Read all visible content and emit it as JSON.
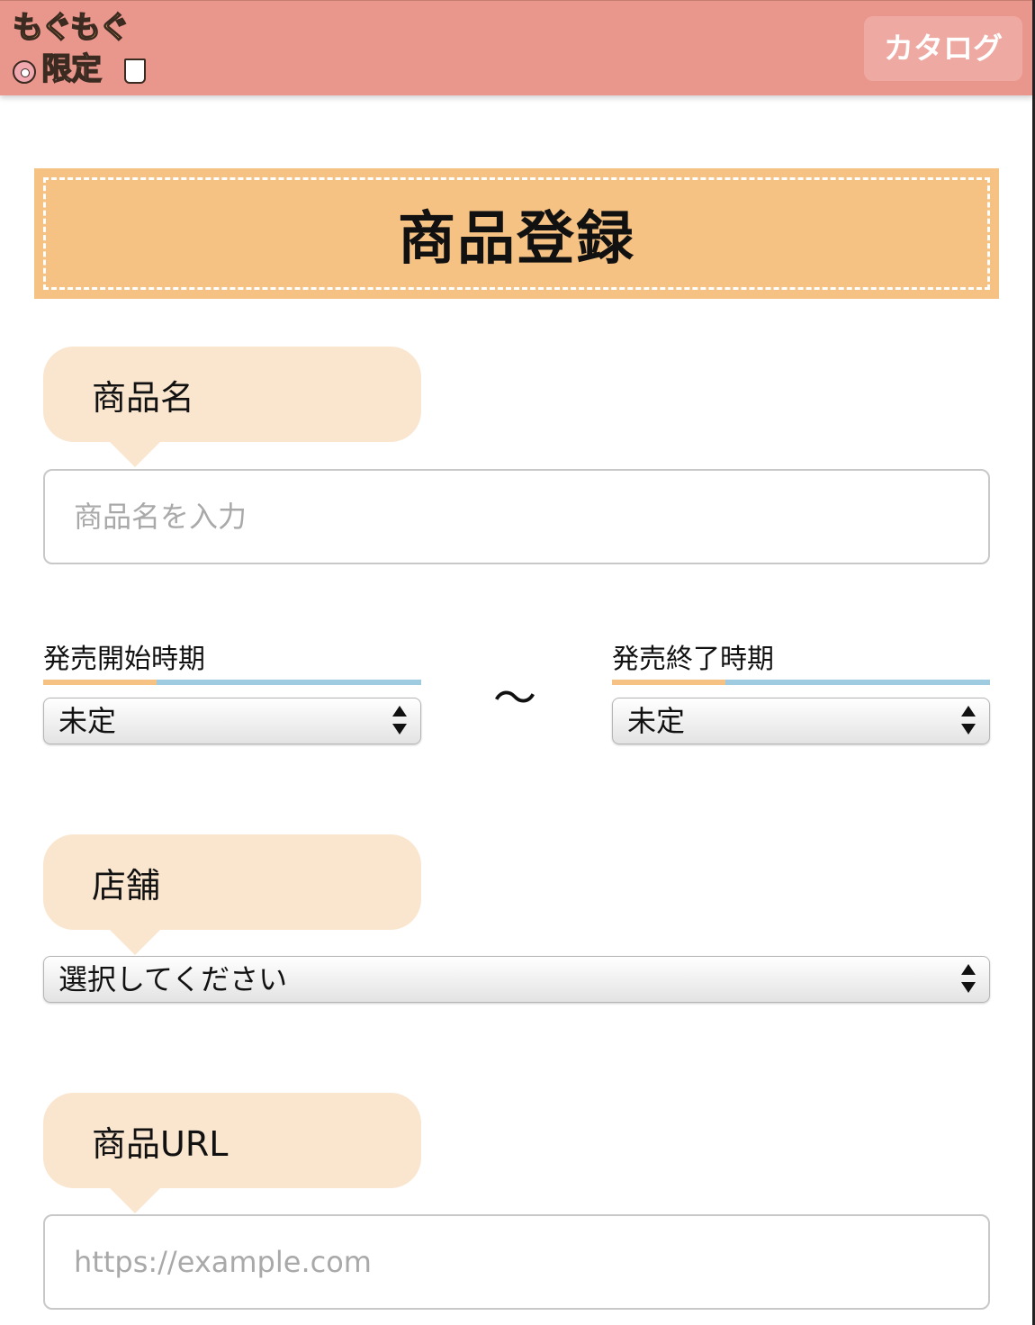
{
  "header": {
    "logo": {
      "line1": "もぐもぐ",
      "line2": "限定"
    },
    "catalog_label": "カタログ",
    "bg_color": "#e9968c"
  },
  "title": "商品登録",
  "form": {
    "product_name": {
      "label": "商品名",
      "placeholder": "商品名を入力"
    },
    "release_start": {
      "label": "発売開始時期",
      "selected": "未定"
    },
    "separator": "〜",
    "release_end": {
      "label": "発売終了時期",
      "selected": "未定"
    },
    "store": {
      "label": "店舗",
      "selected": "選択してください"
    },
    "product_url": {
      "label": "商品URL",
      "placeholder": "https://example.com"
    }
  },
  "colors": {
    "title_bg": "#f5c283",
    "bubble_bg": "#fae6cf",
    "accent_blue": "#9fcbe0",
    "accent_orange": "#f5c283"
  },
  "icons": {
    "select_arrow": "select-arrows-icon",
    "logo_donut": "donut-icon",
    "logo_cup": "cup-icon"
  }
}
